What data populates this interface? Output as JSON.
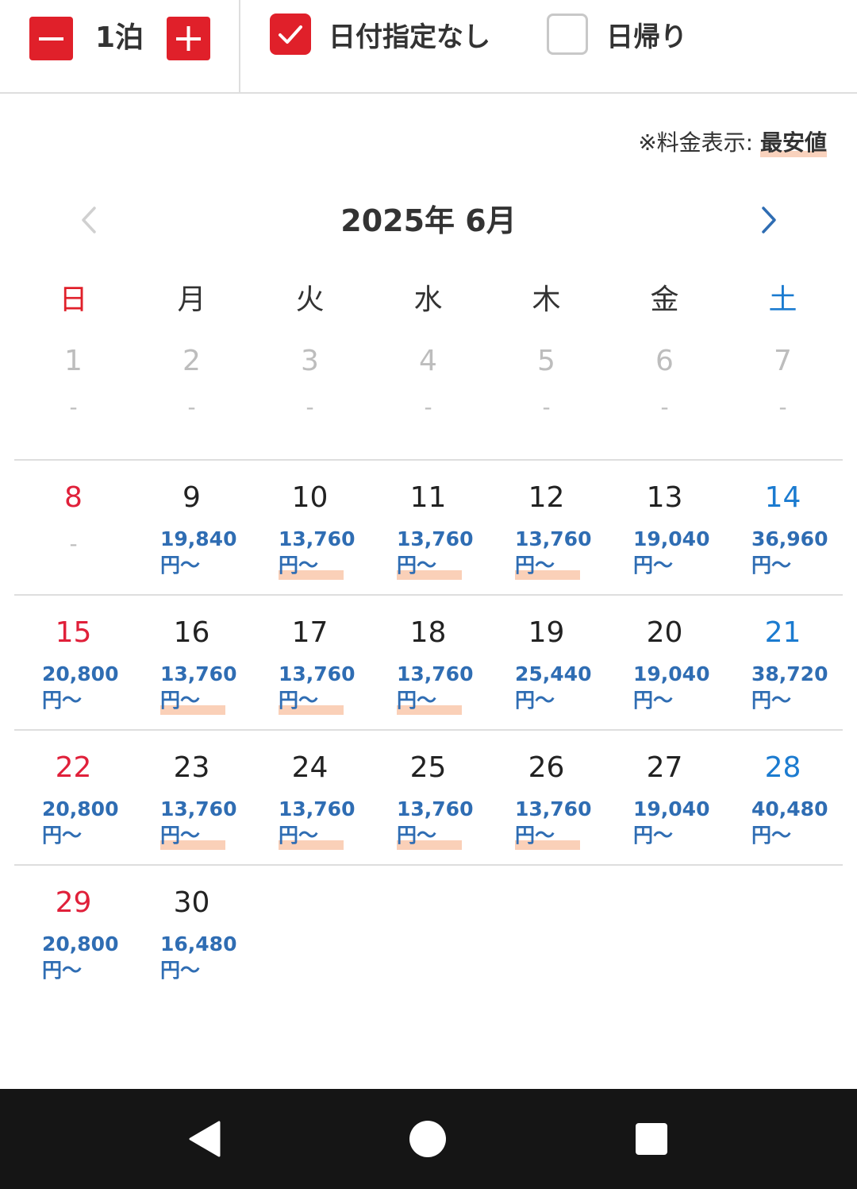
{
  "topbar": {
    "nights_label": "1泊",
    "no_date_label": "日付指定なし",
    "no_date_checked": true,
    "day_trip_label": "日帰り",
    "day_trip_checked": false
  },
  "note": {
    "prefix": "※料金表示: ",
    "value": "最安値"
  },
  "calendar": {
    "month_title": "2025年 6月",
    "weekdays": [
      "日",
      "月",
      "火",
      "水",
      "木",
      "金",
      "土"
    ],
    "weeks": [
      [
        {
          "day": "1",
          "past": true,
          "price": "-",
          "yen": ""
        },
        {
          "day": "2",
          "past": true,
          "price": "-",
          "yen": ""
        },
        {
          "day": "3",
          "past": true,
          "price": "-",
          "yen": ""
        },
        {
          "day": "4",
          "past": true,
          "price": "-",
          "yen": ""
        },
        {
          "day": "5",
          "past": true,
          "price": "-",
          "yen": ""
        },
        {
          "day": "6",
          "past": true,
          "price": "-",
          "yen": ""
        },
        {
          "day": "7",
          "past": true,
          "price": "-",
          "yen": ""
        }
      ],
      [
        {
          "day": "8",
          "past": false,
          "price": "-",
          "yen": ""
        },
        {
          "day": "9",
          "past": false,
          "price": "19,840",
          "yen": "円〜"
        },
        {
          "day": "10",
          "past": false,
          "price": "13,760",
          "yen": "円〜",
          "lowest": true
        },
        {
          "day": "11",
          "past": false,
          "price": "13,760",
          "yen": "円〜",
          "lowest": true
        },
        {
          "day": "12",
          "past": false,
          "price": "13,760",
          "yen": "円〜",
          "lowest": true
        },
        {
          "day": "13",
          "past": false,
          "price": "19,040",
          "yen": "円〜"
        },
        {
          "day": "14",
          "past": false,
          "price": "36,960",
          "yen": "円〜"
        }
      ],
      [
        {
          "day": "15",
          "past": false,
          "price": "20,800",
          "yen": "円〜"
        },
        {
          "day": "16",
          "past": false,
          "price": "13,760",
          "yen": "円〜",
          "lowest": true
        },
        {
          "day": "17",
          "past": false,
          "price": "13,760",
          "yen": "円〜",
          "lowest": true
        },
        {
          "day": "18",
          "past": false,
          "price": "13,760",
          "yen": "円〜",
          "lowest": true
        },
        {
          "day": "19",
          "past": false,
          "price": "25,440",
          "yen": "円〜"
        },
        {
          "day": "20",
          "past": false,
          "price": "19,040",
          "yen": "円〜"
        },
        {
          "day": "21",
          "past": false,
          "price": "38,720",
          "yen": "円〜"
        }
      ],
      [
        {
          "day": "22",
          "past": false,
          "price": "20,800",
          "yen": "円〜"
        },
        {
          "day": "23",
          "past": false,
          "price": "13,760",
          "yen": "円〜",
          "lowest": true
        },
        {
          "day": "24",
          "past": false,
          "price": "13,760",
          "yen": "円〜",
          "lowest": true
        },
        {
          "day": "25",
          "past": false,
          "price": "13,760",
          "yen": "円〜",
          "lowest": true
        },
        {
          "day": "26",
          "past": false,
          "price": "13,760",
          "yen": "円〜",
          "lowest": true
        },
        {
          "day": "27",
          "past": false,
          "price": "19,040",
          "yen": "円〜"
        },
        {
          "day": "28",
          "past": false,
          "price": "40,480",
          "yen": "円〜"
        }
      ],
      [
        {
          "day": "29",
          "past": false,
          "price": "20,800",
          "yen": "円〜"
        },
        {
          "day": "30",
          "past": false,
          "price": "16,480",
          "yen": "円〜"
        }
      ]
    ]
  },
  "colors": {
    "accent_red": "#e0202a",
    "price_blue": "#2f6db3",
    "saturday_blue": "#1b7bd0",
    "lowest_highlight": "#fad0b8"
  },
  "icons": {
    "minus": "minus-icon",
    "plus": "plus-icon",
    "check": "check-icon",
    "prev": "chevron-left-icon",
    "next": "chevron-right-icon",
    "sys_back": "back-triangle-icon",
    "sys_home": "home-circle-icon",
    "sys_recents": "recents-square-icon"
  }
}
